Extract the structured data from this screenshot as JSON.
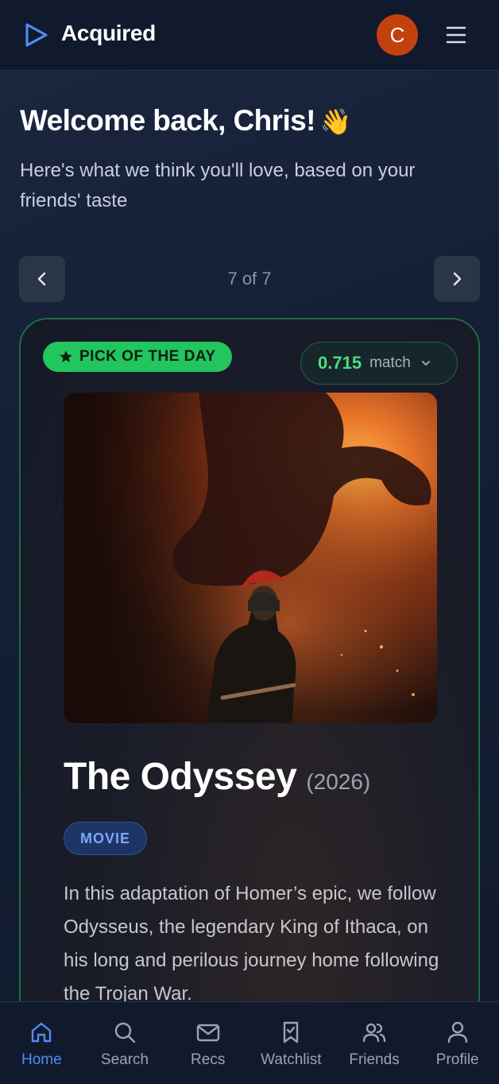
{
  "header": {
    "brand": "Acquired",
    "avatar_initial": "C",
    "logo_icon": "play-outline-icon",
    "menu_icon": "hamburger-icon"
  },
  "welcome": {
    "title": "Welcome back, Chris!",
    "emoji": "👋",
    "subtitle": "Here's what we think you'll love, based on your friends' taste"
  },
  "pager": {
    "count_text": "7 of 7",
    "prev_icon": "chevron-left-icon",
    "next_icon": "chevron-right-icon"
  },
  "card": {
    "badge": "PICK OF THE DAY",
    "badge_icon": "star-icon",
    "match_score": "0.715",
    "match_label": "match",
    "title": "The Odyssey",
    "year": "(2026)",
    "type": "MOVIE",
    "description": "In this adaptation of Homer’s epic, we follow Odysseus, the legendary King of Ithaca, on his long and perilous journey home following the Trojan War.",
    "poster_alt": "Warrior in crested helmet before a burning giant horse"
  },
  "nav": {
    "items": [
      {
        "label": "Home",
        "icon": "home-icon",
        "active": true
      },
      {
        "label": "Search",
        "icon": "search-icon",
        "active": false
      },
      {
        "label": "Recs",
        "icon": "mail-icon",
        "active": false
      },
      {
        "label": "Watchlist",
        "icon": "bookmark-check-icon",
        "active": false
      },
      {
        "label": "Friends",
        "icon": "users-icon",
        "active": false
      },
      {
        "label": "Profile",
        "icon": "user-icon",
        "active": false
      }
    ]
  },
  "colors": {
    "accent_blue": "#4f8df7",
    "accent_green": "#22c55e",
    "avatar_bg": "#c2410c",
    "background": "#111a2c"
  }
}
